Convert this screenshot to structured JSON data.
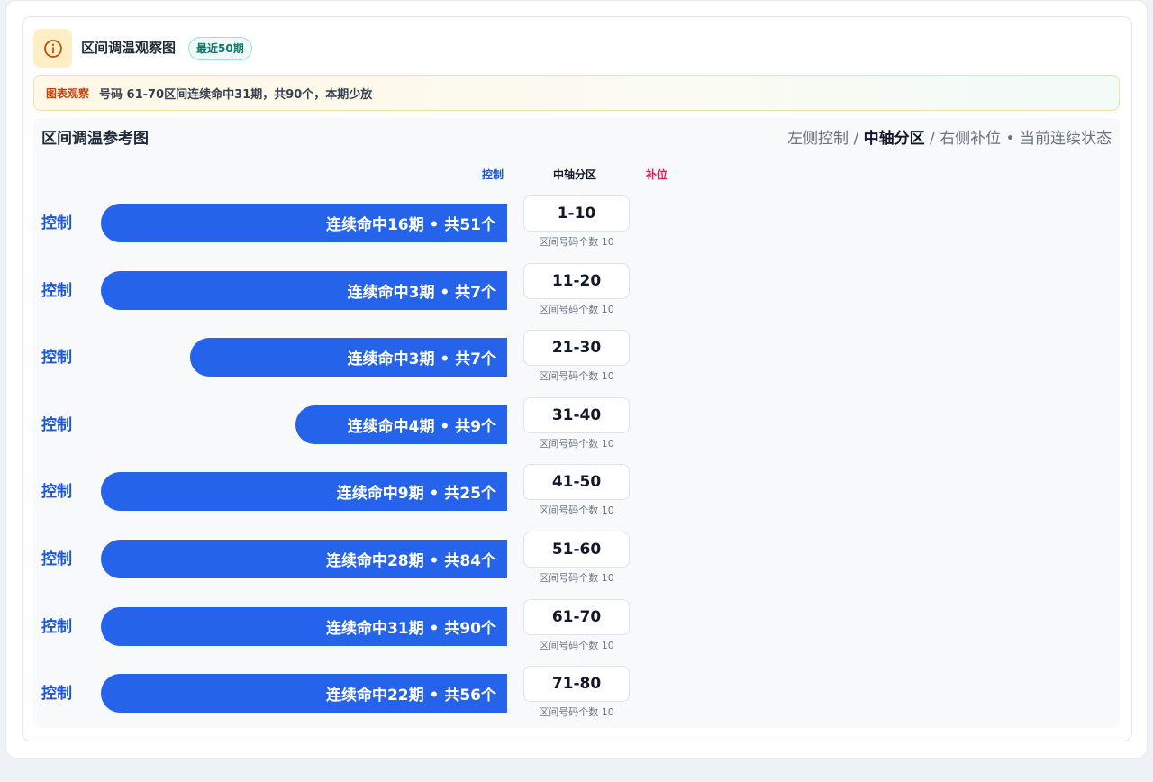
{
  "header": {
    "icon": "info-icon",
    "title": "区间调温观察图",
    "badge": "最近50期"
  },
  "observation": {
    "label": "图表观察",
    "text": "号码 61-70区间连续命中31期，共90个，本期少放"
  },
  "chart": {
    "title": "区间调温参考图",
    "legend": {
      "left": "左侧控制",
      "sep1": " / ",
      "center": "中轴分区",
      "sep2": " / ",
      "right": "右侧补位",
      "dot": " • ",
      "status": "当前连续状态"
    },
    "columns": {
      "left": "控制",
      "center": "中轴分区",
      "right": "补位"
    },
    "colors": {
      "bar": "#2563eb",
      "control_label": "#1d56d8",
      "fill_label": "#e11d48"
    }
  },
  "chart_data": {
    "type": "bar",
    "orientation": "horizontal-left",
    "categories": [
      "1-10",
      "11-20",
      "21-30",
      "31-40",
      "41-50",
      "51-60",
      "61-70",
      "71-80"
    ],
    "series": [
      {
        "name": "控制",
        "streak": [
          16,
          3,
          3,
          4,
          9,
          28,
          31,
          22
        ],
        "total": [
          51,
          7,
          7,
          9,
          25,
          84,
          90,
          56
        ],
        "labels": [
          "连续命中16期 • 共51个",
          "连续命中3期 • 共7个",
          "连续命中3期 • 共7个",
          "连续命中4期 • 共9个",
          "连续命中9期 • 共25个",
          "连续命中28期 • 共84个",
          "连续命中31期 • 共90个",
          "连续命中22期 • 共56个"
        ]
      }
    ],
    "bar_fill_fraction": [
      1.0,
      1.0,
      0.78,
      0.52,
      1.0,
      1.0,
      1.0,
      1.0
    ],
    "rows": [
      {
        "side": "控制",
        "range": "1-10",
        "sub": "区间号码个数 10"
      },
      {
        "side": "控制",
        "range": "11-20",
        "sub": "区间号码个数 10"
      },
      {
        "side": "控制",
        "range": "21-30",
        "sub": "区间号码个数 10"
      },
      {
        "side": "控制",
        "range": "31-40",
        "sub": "区间号码个数 10"
      },
      {
        "side": "控制",
        "range": "41-50",
        "sub": "区间号码个数 10"
      },
      {
        "side": "控制",
        "range": "51-60",
        "sub": "区间号码个数 10"
      },
      {
        "side": "控制",
        "range": "61-70",
        "sub": "区间号码个数 10"
      },
      {
        "side": "控制",
        "range": "71-80",
        "sub": "区间号码个数 10"
      }
    ]
  }
}
